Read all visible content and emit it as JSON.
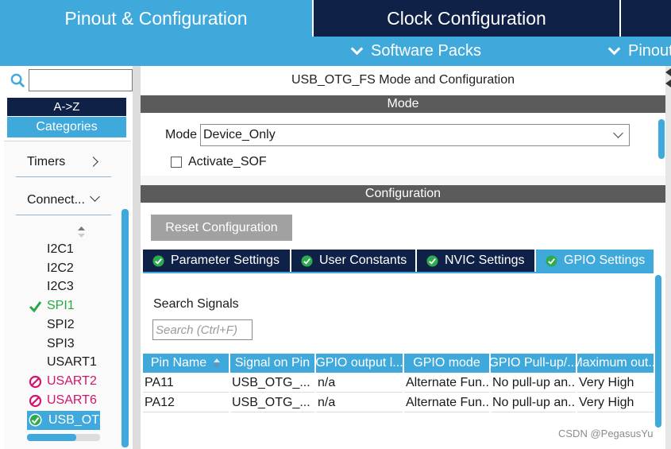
{
  "top_tabs": {
    "pinout": "Pinout & Configuration",
    "clock": "Clock Configuration"
  },
  "sub_bar": {
    "software_packs": "Software Packs",
    "pinout": "Pinout"
  },
  "sidebar": {
    "search_value": "",
    "sort_az": "A->Z",
    "categories": "Categories",
    "category_timers": "Timers",
    "category_connectivity": "Connect...",
    "peripherals": [
      {
        "label": "I2C1",
        "status": "none"
      },
      {
        "label": "I2C2",
        "status": "none"
      },
      {
        "label": "I2C3",
        "status": "none"
      },
      {
        "label": "SPI1",
        "status": "ok"
      },
      {
        "label": "SPI2",
        "status": "none"
      },
      {
        "label": "SPI3",
        "status": "none"
      },
      {
        "label": "USART1",
        "status": "none"
      },
      {
        "label": "USART2",
        "status": "conflict"
      },
      {
        "label": "USART6",
        "status": "conflict"
      },
      {
        "label": "USB_OTG",
        "status": "ok-selected"
      }
    ]
  },
  "main": {
    "title": "USB_OTG_FS Mode and Configuration",
    "mode_section": {
      "header": "Mode",
      "mode_label": "Mode",
      "mode_value": "Device_Only",
      "activate_sof_label": "Activate_SOF",
      "activate_sof_checked": false
    },
    "config_section": {
      "header": "Configuration",
      "reset_button": "Reset Configuration",
      "tabs": [
        {
          "label": "Parameter Settings",
          "active": false
        },
        {
          "label": "User Constants",
          "active": false
        },
        {
          "label": "NVIC Settings",
          "active": false
        },
        {
          "label": "GPIO Settings",
          "active": true
        }
      ],
      "search_signals_label": "Search Signals",
      "search_placeholder": "Search (Ctrl+F)",
      "table": {
        "columns": [
          "Pin Name",
          "Signal on Pin",
          "GPIO output l...",
          "GPIO mode",
          "GPIO Pull-up/...",
          "Maximum out..."
        ],
        "rows": [
          [
            "PA11",
            "USB_OTG_...",
            "n/a",
            "Alternate Fun...",
            "No pull-up an...",
            "Very High"
          ],
          [
            "PA12",
            "USB_OTG_...",
            "n/a",
            "Alternate Fun...",
            "No pull-up an...",
            "Very High"
          ]
        ]
      }
    }
  },
  "watermark": "CSDN @PegasusYu",
  "colors": {
    "accent_blue": "#3fa9dc",
    "navy": "#0f2147",
    "ok_green": "#27a745",
    "conflict_pink": "#d3146c",
    "section_gray": "#5b5b5b"
  }
}
